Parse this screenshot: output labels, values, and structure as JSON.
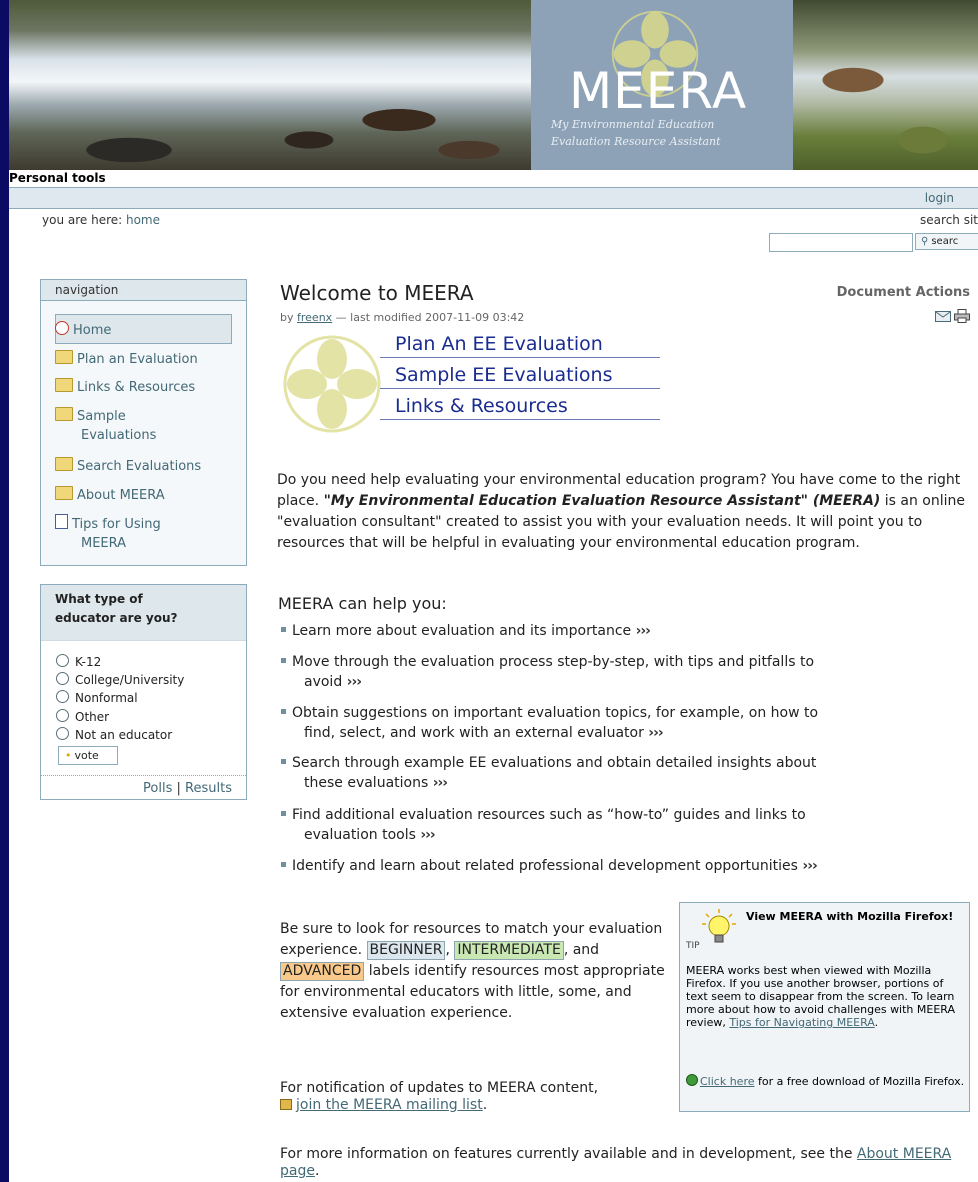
{
  "banner": {
    "title": "MEERA",
    "tagline_line1": "My Environmental Education",
    "tagline_line2": "Evaluation Resource Assistant"
  },
  "personal_tools": {
    "label": "Personal tools",
    "login": "login"
  },
  "breadcrumb": {
    "prefix": "you are here: ",
    "home": "home"
  },
  "search": {
    "label": "search sit",
    "input_value": "",
    "button_label": "searc"
  },
  "navigation": {
    "header": "navigation",
    "items": [
      {
        "label": "Home",
        "icon": "home-icon"
      },
      {
        "label": "Plan an Evaluation",
        "icon": "folder-icon"
      },
      {
        "label": "Links & Resources",
        "icon": "folder-icon"
      },
      {
        "label": "Sample",
        "label2": "Evaluations",
        "icon": "folder-icon"
      },
      {
        "label": "Search Evaluations",
        "icon": "folder-icon"
      },
      {
        "label": "About MEERA",
        "icon": "folder-icon"
      },
      {
        "label": "Tips for Using",
        "label2": "MEERA",
        "icon": "document-icon"
      }
    ]
  },
  "poll": {
    "question_line1": "What type of",
    "question_line2": "educator are you?",
    "options": [
      "K-12",
      "College/University",
      "Nonformal",
      "Other",
      "Not an educator"
    ],
    "vote": "vote",
    "polls": "Polls",
    "separator": "|",
    "results": "Results"
  },
  "document": {
    "title": "Welcome to MEERA",
    "actions": "Document Actions",
    "by": "by ",
    "author": "freenx",
    "modified": " — last modified 2007-11-09 03:42"
  },
  "quick_links": [
    "Plan An EE Evaluation",
    "Sample EE Evaluations",
    "Links & Resources"
  ],
  "intro": {
    "part1": "Do you need help evaluating your environmental education program? You have come to the right place. ",
    "emphasis": "\"My Environmental Education Evaluation Resource Assistant\" (MEERA)",
    "part2": " is an online \"evaluation consultant\" created to assist you with your evaluation needs. It will point you to resources that will be helpful in evaluating your environmental education program."
  },
  "help": {
    "heading": "MEERA can help you:",
    "more_marker": "›››",
    "items": [
      {
        "line1": "Learn more about evaluation and its importance",
        "line2": ""
      },
      {
        "line1": "Move through the evaluation process step-by-step, with tips and pitfalls to",
        "line2": "avoid"
      },
      {
        "line1": "Obtain suggestions on important evaluation topics, for example, on how to",
        "line2": "find, select, and work with an external evaluator"
      },
      {
        "line1": "Search through example EE evaluations and obtain detailed insights about",
        "line2": "these evaluations"
      },
      {
        "line1": "Find additional evaluation resources such as “how-to” guides and links to",
        "line2": "evaluation tools"
      },
      {
        "line1": "Identify and learn about related professional development opportunities",
        "line2": ""
      }
    ]
  },
  "levels": {
    "part1": "Be sure to look for resources to match your evaluation experience. ",
    "beginner": "BEGINNER",
    "comma": ",",
    "intermediate": "INTERMEDIATE",
    "and": ", and ",
    "advanced": "ADVANCED",
    "part2": " labels identify resources most appropriate for environmental educators with little, some, and extensive evaluation experience."
  },
  "notify": {
    "text": "For notification of updates to MEERA content,",
    "link": "join the MEERA mailing list",
    "end": "."
  },
  "more_info": {
    "text": "For more information on features currently available and in development, see the ",
    "link": "About MEERA page",
    "end": "."
  },
  "tip": {
    "label": "TIP",
    "title": "View MEERA with Mozilla Firefox!",
    "body": "MEERA works best when viewed with Mozilla Firefox. If you use another browser, portions of text seem to disappear from the screen. To learn more about how to avoid challenges with MEERA review, ",
    "body_link": "Tips for Navigating MEERA",
    "body_end": ".",
    "foot_link": "Click here",
    "foot_text": " for a free download of Mozilla Firefox."
  },
  "colors": {
    "frame": "#0b0b63",
    "accent": "#436976",
    "border": "#8cacbb",
    "quicklink": "#1a2c8f",
    "beginner": "#dbe7ed",
    "intermediate": "#c9e7b3",
    "advanced": "#f8c98a"
  }
}
